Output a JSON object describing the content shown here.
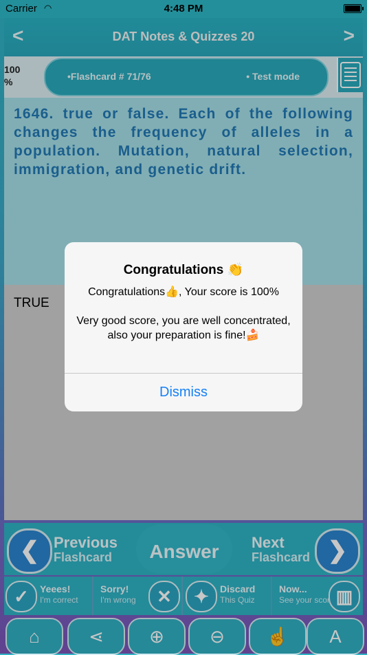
{
  "status": {
    "carrier": "Carrier",
    "time": "4:48 PM"
  },
  "nav": {
    "title": "DAT Notes & Quizzes 20",
    "back": "<",
    "forward": ">"
  },
  "progress": {
    "percent_line1": "100",
    "percent_line2": "%"
  },
  "flashcard": {
    "label": "•Flashcard #  71/76",
    "mode": "• Test mode"
  },
  "question": {
    "text": "1646. true or false. Each of the following changes the frequency of alleles in a population. Mutation, natural selection, immigration, and genetic drift."
  },
  "answer": {
    "text": "TRUE"
  },
  "alert": {
    "title": "Congratulations 👏",
    "line1": "Congratulations👍, Your score is 100%",
    "line2": "Very good score, you are well concentrated, also your preparation is fine!🍰",
    "dismiss": "Dismiss"
  },
  "controls": {
    "previous": {
      "line1": "Previous",
      "line2": "Flashcard"
    },
    "answer": "Answer",
    "next": {
      "line1": "Next",
      "line2": "Flashcard"
    }
  },
  "actions": [
    {
      "line1": "Yeees!",
      "line2": "I'm correct"
    },
    {
      "line1": "Sorry!",
      "line2": "I'm wrong"
    },
    {
      "line1": "Discard",
      "line2": "This Quiz"
    },
    {
      "line1": "Now...",
      "line2": "See your score"
    }
  ],
  "colors": {
    "accent": "#2fb2c4",
    "question_text": "#2279b5",
    "link": "#1580f5"
  }
}
